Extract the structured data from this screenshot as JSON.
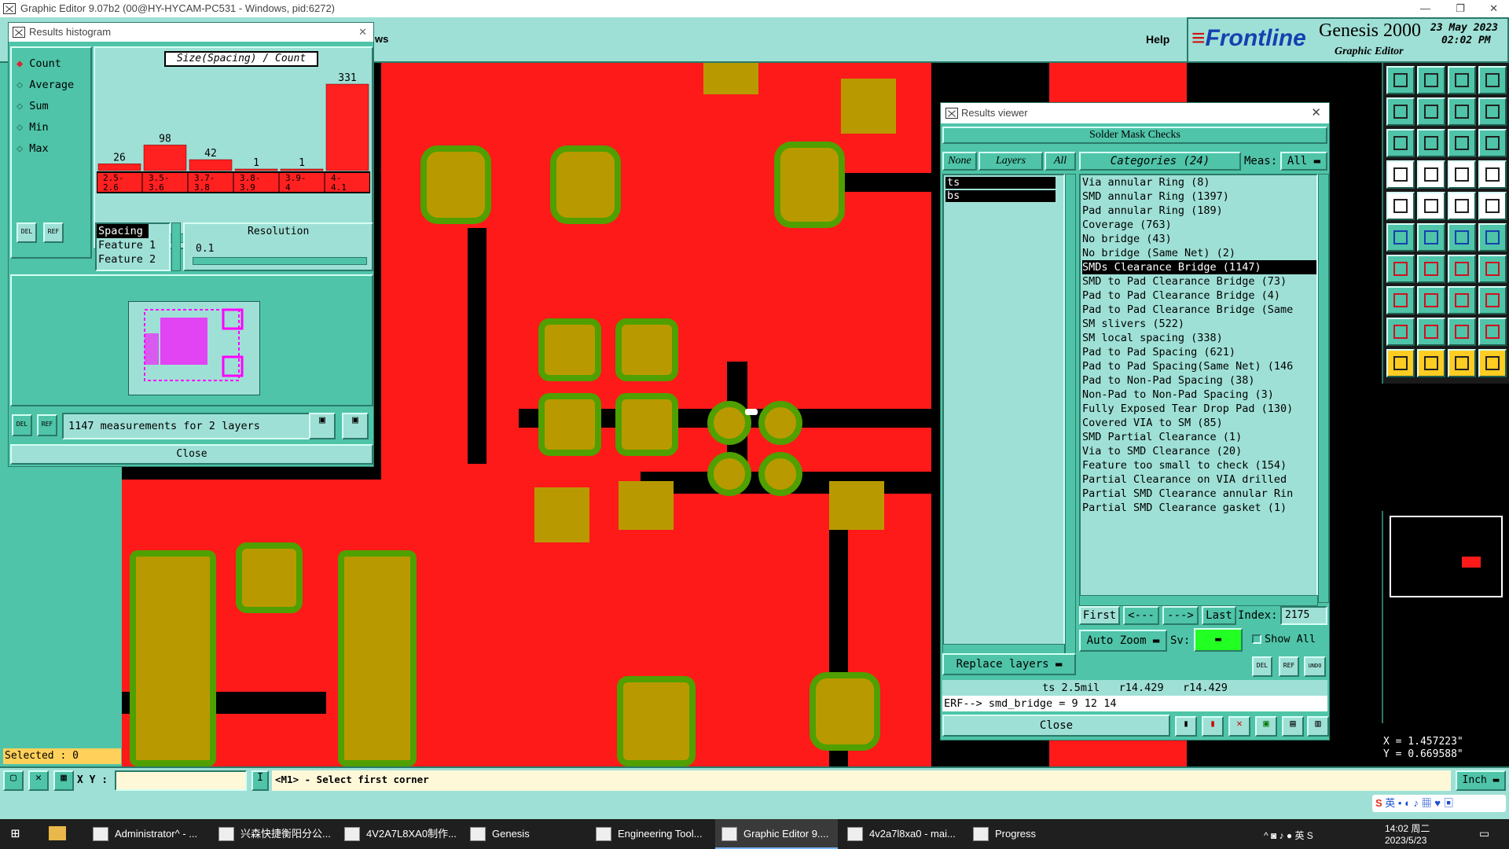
{
  "window": {
    "title": "Graphic Editor 9.07b2 (00@HY-HYCAM-PC531 - Windows, pid:6272)"
  },
  "menu": {
    "partial": "ws",
    "help": "Help"
  },
  "brand": {
    "logo": "Frontline",
    "product": "Genesis 2000",
    "subtitle": "Graphic Editor",
    "date": "23 May 2023",
    "time": "02:02 PM"
  },
  "histogram": {
    "title": "Results histogram",
    "options": [
      {
        "label": "Count",
        "selected": true
      },
      {
        "label": "Average",
        "selected": false
      },
      {
        "label": "Sum",
        "selected": false
      },
      {
        "label": "Min",
        "selected": false
      },
      {
        "label": "Max",
        "selected": false
      }
    ],
    "chart_title": "Size(Spacing) / Count",
    "list": [
      "Spacing",
      "Feature 1",
      "Feature 2"
    ],
    "resolution_label": "Resolution",
    "resolution_value": "0.1",
    "measurements": "1147 measurements for 2 layers",
    "close": "Close",
    "del": "DEL",
    "ref": "REF"
  },
  "chart_data": {
    "type": "bar",
    "title": "Size(Spacing) / Count",
    "categories": [
      "2.5-2.6",
      "3.5-3.6",
      "3.7-3.8",
      "3.8-3.9",
      "3.9-4",
      "4-4.1"
    ],
    "values": [
      26,
      98,
      42,
      1,
      1,
      331
    ],
    "bar_color": "#ff2020"
  },
  "results": {
    "title": "Results viewer",
    "header": "Solder Mask Checks",
    "none": "None",
    "layers_btn": "Layers",
    "all": "All",
    "categories_btn": "Categories (24)",
    "meas_label": "Meas:",
    "meas_value": "All",
    "layers": [
      "ts",
      "bs"
    ],
    "categories": [
      "Via annular Ring (8)",
      "SMD annular Ring (1397)",
      "Pad annular Ring (189)",
      "Coverage (763)",
      "No bridge (43)",
      "No bridge (Same Net) (2)",
      "SMDs Clearance Bridge (1147)",
      "SMD to Pad Clearance Bridge (73)",
      "Pad to Pad Clearance Bridge (4)",
      "Pad to Pad Clearance Bridge (Same",
      "SM slivers (522)",
      "SM local spacing (338)",
      "Pad to Pad Spacing (621)",
      "Pad to Pad Spacing(Same Net) (146",
      "Pad to Non-Pad Spacing (38)",
      "Non-Pad to Non-Pad Spacing (3)",
      "Fully Exposed Tear Drop Pad (130)",
      "Covered VIA to SM (85)",
      "SMD Partial Clearance (1)",
      "Via to SMD Clearance (20)",
      "Feature too small to check (154)",
      "Partial Clearance on VIA drilled",
      "Partial SMD Clearance annular Rin",
      "Partial SMD Clearance gasket (1)"
    ],
    "selected_index": 6,
    "first": "First",
    "prev": "<---",
    "next": "--->",
    "last": "Last",
    "index_label": "Index:",
    "index_value": "2175",
    "auto_zoom": "Auto Zoom",
    "sv_label": "Sv:",
    "show_all": "Show All",
    "replace_layers": "Replace layers",
    "info_line": "ts 2.5mil   r14.429   r14.429",
    "erf_line": "ERF--> smd_bridge = 9 12 14",
    "close": "Close",
    "del": "DEL",
    "ref": "REF",
    "undo": "UNDO"
  },
  "status": {
    "selected": "Selected : 0",
    "xy_label": "X Y :",
    "xy_value": "",
    "prompt": "<M1> - Select first corner",
    "coord_x": "X = 1.457223\"",
    "coord_y": "Y = 0.669588\"",
    "units": "Inch"
  },
  "taskbar": {
    "items": [
      "Administrator^ - ...",
      "兴森快捷衡阳分公...",
      "4V2A7L8XA0制作...",
      "Genesis",
      "Engineering Tool...",
      "Graphic Editor 9....",
      "4v2a7l8xa0 - mai...",
      "Progress"
    ],
    "time": "14:02 周二",
    "date": "2023/5/23",
    "ime": "英"
  }
}
